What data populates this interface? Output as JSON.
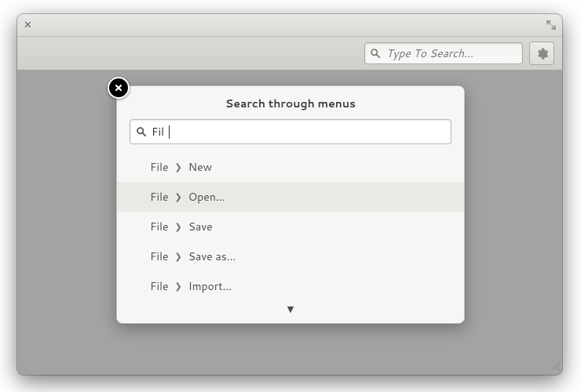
{
  "toolbar": {
    "search_placeholder": "Type To Search…"
  },
  "popover": {
    "title": "Search through menus",
    "query": "Fil",
    "results": [
      {
        "menu": "File",
        "command": "New",
        "highlighted": false
      },
      {
        "menu": "File",
        "command": "Open…",
        "highlighted": true
      },
      {
        "menu": "File",
        "command": "Save",
        "highlighted": false
      },
      {
        "menu": "File",
        "command": "Save as…",
        "highlighted": false
      },
      {
        "menu": "File",
        "command": "Import…",
        "highlighted": false
      }
    ],
    "has_more": true
  }
}
